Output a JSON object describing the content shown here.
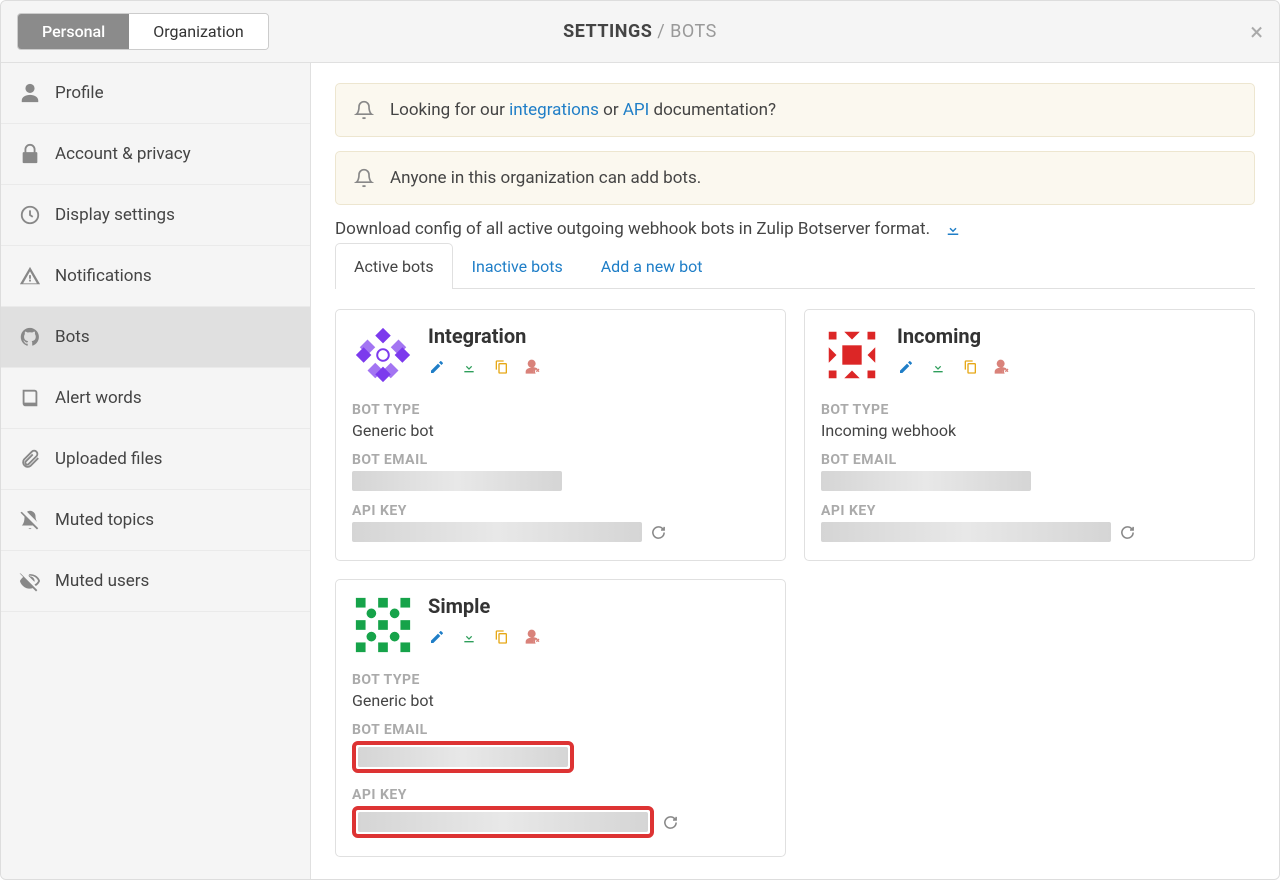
{
  "header": {
    "tab_personal": "Personal",
    "tab_organization": "Organization",
    "title_strong": "SETTINGS",
    "title_sep": " / ",
    "title_light": "BOTS"
  },
  "sidebar": {
    "items": [
      {
        "label": "Profile",
        "icon": "user"
      },
      {
        "label": "Account & privacy",
        "icon": "lock"
      },
      {
        "label": "Display settings",
        "icon": "clock"
      },
      {
        "label": "Notifications",
        "icon": "alert"
      },
      {
        "label": "Bots",
        "icon": "github"
      },
      {
        "label": "Alert words",
        "icon": "book"
      },
      {
        "label": "Uploaded files",
        "icon": "paperclip"
      },
      {
        "label": "Muted topics",
        "icon": "bell-off"
      },
      {
        "label": "Muted users",
        "icon": "eye-off"
      }
    ],
    "active_index": 4
  },
  "notices": {
    "n1_pre": "Looking for our ",
    "n1_link1": "integrations",
    "n1_mid": " or ",
    "n1_link2": "API",
    "n1_post": " documentation?",
    "n2": "Anyone in this organization can add bots."
  },
  "download_text": "Download config of all active outgoing webhook bots in Zulip Botserver format.",
  "subtabs": {
    "active": "Active bots",
    "inactive": "Inactive bots",
    "add": "Add a new bot"
  },
  "labels": {
    "bot_type": "BOT TYPE",
    "bot_email": "BOT EMAIL",
    "api_key": "API KEY"
  },
  "bots": [
    {
      "name": "Integration",
      "type_value": "Generic bot",
      "avatar_color": "#7c3aed",
      "highlighted": false
    },
    {
      "name": "Incoming",
      "type_value": "Incoming webhook",
      "avatar_color": "#dc2626",
      "highlighted": false
    },
    {
      "name": "Simple",
      "type_value": "Generic bot",
      "avatar_color": "#16a34a",
      "highlighted": true
    }
  ],
  "colors": {
    "edit": "#1f7ec7",
    "download": "#2e9e5b",
    "copy": "#e6a817",
    "deactivate": "#d9827a"
  }
}
